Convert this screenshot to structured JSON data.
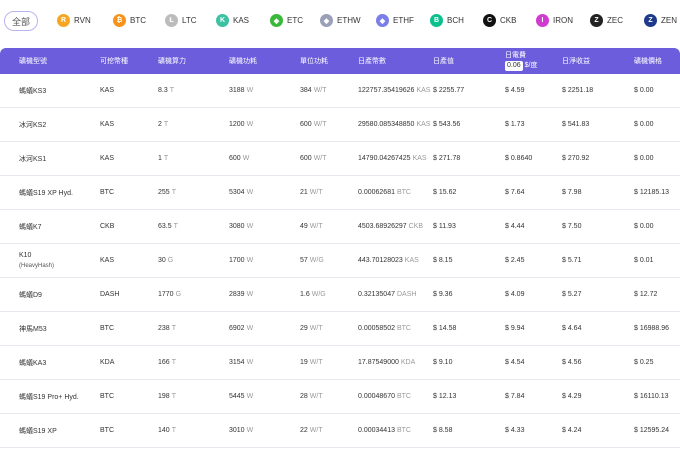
{
  "filter": {
    "all_label": "全部",
    "coins": [
      {
        "label": "RVN",
        "icon": "rvn-icon",
        "color": "#f5a623",
        "glyph": "R"
      },
      {
        "label": "BTC",
        "icon": "btc-icon",
        "color": "#f7931a",
        "glyph": "₿"
      },
      {
        "label": "LTC",
        "icon": "ltc-icon",
        "color": "#bcbcbc",
        "glyph": "Ł"
      },
      {
        "label": "KAS",
        "icon": "kas-icon",
        "color": "#3cc2a3",
        "glyph": "K"
      },
      {
        "label": "ETC",
        "icon": "etc-icon",
        "color": "#3ab83a",
        "glyph": "◆"
      },
      {
        "label": "ETHW",
        "icon": "ethw-icon",
        "color": "#9aa0b8",
        "glyph": "◆"
      },
      {
        "label": "ETHF",
        "icon": "ethf-icon",
        "color": "#7b7ee8",
        "glyph": "◆"
      },
      {
        "label": "BCH",
        "icon": "bch-icon",
        "color": "#0ac18e",
        "glyph": "B"
      },
      {
        "label": "CKB",
        "icon": "ckb-icon",
        "color": "#111111",
        "glyph": "C"
      },
      {
        "label": "IRON",
        "icon": "iron-icon",
        "color": "#d03cd0",
        "glyph": "I"
      },
      {
        "label": "ZEC",
        "icon": "zec-icon",
        "color": "#222222",
        "glyph": "Z"
      },
      {
        "label": "ZEN",
        "icon": "zen-icon",
        "color": "#1e3a8a",
        "glyph": "Z"
      }
    ]
  },
  "table": {
    "headers": {
      "model": "礦機型號",
      "coin": "可挖幣種",
      "hashrate": "礦機算力",
      "power": "礦機功耗",
      "efficiency": "單位功耗",
      "daily_output": "日產幣數",
      "daily_value": "日產值",
      "electricity": "日電費",
      "rate_value": "0.06",
      "rate_unit": "$/度",
      "daily_profit": "日淨收益",
      "price": "礦機價格"
    },
    "rows": [
      {
        "model": "螞蟻KS3",
        "sub": "",
        "coin": "KAS",
        "hashrate": "8.3",
        "hr_unit": "T",
        "power": "3188",
        "pw_unit": "W",
        "eff": "384",
        "eff_unit": "W/T",
        "output": "122757.35419626",
        "out_unit": "KAS",
        "value": "$ 2255.77",
        "elec": "$ 4.59",
        "profit": "$ 2251.18",
        "price": "$ 0.00"
      },
      {
        "model": "冰河KS2",
        "sub": "",
        "coin": "KAS",
        "hashrate": "2",
        "hr_unit": "T",
        "power": "1200",
        "pw_unit": "W",
        "eff": "600",
        "eff_unit": "W/T",
        "output": "29580.085348850",
        "out_unit": "KAS",
        "value": "$ 543.56",
        "elec": "$ 1.73",
        "profit": "$ 541.83",
        "price": "$ 0.00"
      },
      {
        "model": "冰河KS1",
        "sub": "",
        "coin": "KAS",
        "hashrate": "1",
        "hr_unit": "T",
        "power": "600",
        "pw_unit": "W",
        "eff": "600",
        "eff_unit": "W/T",
        "output": "14790.04267425",
        "out_unit": "KAS",
        "value": "$ 271.78",
        "elec": "$ 0.8640",
        "profit": "$ 270.92",
        "price": "$ 0.00"
      },
      {
        "model": "螞蟻S19 XP Hyd.",
        "sub": "",
        "coin": "BTC",
        "hashrate": "255",
        "hr_unit": "T",
        "power": "5304",
        "pw_unit": "W",
        "eff": "21",
        "eff_unit": "W/T",
        "output": "0.00062681",
        "out_unit": "BTC",
        "value": "$ 15.62",
        "elec": "$ 7.64",
        "profit": "$ 7.98",
        "price": "$ 12185.13"
      },
      {
        "model": "螞蟻K7",
        "sub": "",
        "coin": "CKB",
        "hashrate": "63.5",
        "hr_unit": "T",
        "power": "3080",
        "pw_unit": "W",
        "eff": "49",
        "eff_unit": "W/T",
        "output": "4503.68926297",
        "out_unit": "CKB",
        "value": "$ 11.93",
        "elec": "$ 4.44",
        "profit": "$ 7.50",
        "price": "$ 0.00"
      },
      {
        "model": "K10",
        "sub": "(HeavyHash)",
        "coin": "KAS",
        "hashrate": "30",
        "hr_unit": "G",
        "power": "1700",
        "pw_unit": "W",
        "eff": "57",
        "eff_unit": "W/G",
        "output": "443.70128023",
        "out_unit": "KAS",
        "value": "$ 8.15",
        "elec": "$ 2.45",
        "profit": "$ 5.71",
        "price": "$ 0.01"
      },
      {
        "model": "螞蟻D9",
        "sub": "",
        "coin": "DASH",
        "hashrate": "1770",
        "hr_unit": "G",
        "power": "2839",
        "pw_unit": "W",
        "eff": "1.6",
        "eff_unit": "W/G",
        "output": "0.32135047",
        "out_unit": "DASH",
        "value": "$ 9.36",
        "elec": "$ 4.09",
        "profit": "$ 5.27",
        "price": "$ 12.72"
      },
      {
        "model": "神馬M53",
        "sub": "",
        "coin": "BTC",
        "hashrate": "238",
        "hr_unit": "T",
        "power": "6902",
        "pw_unit": "W",
        "eff": "29",
        "eff_unit": "W/T",
        "output": "0.00058502",
        "out_unit": "BTC",
        "value": "$ 14.58",
        "elec": "$ 9.94",
        "profit": "$ 4.64",
        "price": "$ 16988.96"
      },
      {
        "model": "螞蟻KA3",
        "sub": "",
        "coin": "KDA",
        "hashrate": "166",
        "hr_unit": "T",
        "power": "3154",
        "pw_unit": "W",
        "eff": "19",
        "eff_unit": "W/T",
        "output": "17.87549000",
        "out_unit": "KDA",
        "value": "$ 9.10",
        "elec": "$ 4.54",
        "profit": "$ 4.56",
        "price": "$ 0.25"
      },
      {
        "model": "螞蟻S19 Pro+ Hyd.",
        "sub": "",
        "coin": "BTC",
        "hashrate": "198",
        "hr_unit": "T",
        "power": "5445",
        "pw_unit": "W",
        "eff": "28",
        "eff_unit": "W/T",
        "output": "0.00048670",
        "out_unit": "BTC",
        "value": "$ 12.13",
        "elec": "$ 7.84",
        "profit": "$ 4.29",
        "price": "$ 16110.13"
      },
      {
        "model": "螞蟻S19 XP",
        "sub": "",
        "coin": "BTC",
        "hashrate": "140",
        "hr_unit": "T",
        "power": "3010",
        "pw_unit": "W",
        "eff": "22",
        "eff_unit": "W/T",
        "output": "0.00034413",
        "out_unit": "BTC",
        "value": "$ 8.58",
        "elec": "$ 4.33",
        "profit": "$ 4.24",
        "price": "$ 12595.24"
      }
    ]
  }
}
